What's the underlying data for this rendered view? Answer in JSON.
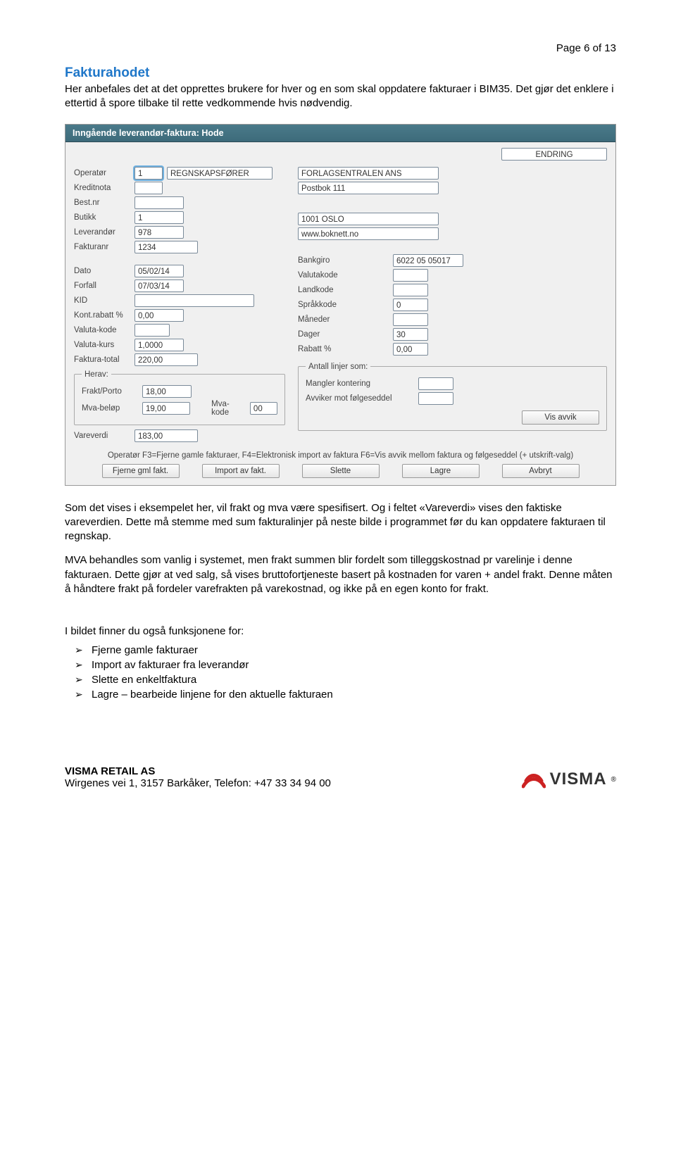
{
  "page_number": "Page 6 of 13",
  "heading": "Fakturahodet",
  "intro": "Her anbefales det at det opprettes brukere for hver og en som skal oppdatere fakturaer i BIM35. Det gjør det enklere i ettertid å spore tilbake til rette vedkommende hvis nødvendig.",
  "form": {
    "title": "Inngående leverandør-faktura: Hode",
    "mode_label": "ENDRING",
    "left": {
      "operator_label": "Operatør",
      "operator_value": "1",
      "operator_name": "REGNSKAPSFØRER",
      "kreditnota_label": "Kreditnota",
      "bestnr_label": "Best.nr",
      "butikk_label": "Butikk",
      "butikk_value": "1",
      "leverandor_label": "Leverandør",
      "leverandor_value": "978",
      "fakturanr_label": "Fakturanr",
      "fakturanr_value": "1234",
      "dato_label": "Dato",
      "dato_value": "05/02/14",
      "forfall_label": "Forfall",
      "forfall_value": "07/03/14",
      "kid_label": "KID",
      "kontrabatt_label": "Kont.rabatt %",
      "kontrabatt_value": "0,00",
      "valutakode_label": "Valuta-kode",
      "valutakurs_label": "Valuta-kurs",
      "valutakurs_value": "1,0000",
      "fakturatotal_label": "Faktura-total",
      "fakturatotal_value": "220,00",
      "herav_legend": "Herav:",
      "fraktporto_label": "Frakt/Porto",
      "fraktporto_value": "18,00",
      "mvabelop_label": "Mva-beløp",
      "mvabelop_value": "19,00",
      "mvakode_label": "Mva-kode",
      "mvakode_value": "00",
      "vareverdi_label": "Vareverdi",
      "vareverdi_value": "183,00"
    },
    "right": {
      "company": "FORLAGSENTRALEN ANS",
      "addr1": "Postbok 111",
      "addr2": "1001 OSLO",
      "url": "www.boknett.no",
      "bankgiro_label": "Bankgiro",
      "bankgiro_value": "6022 05 05017",
      "valutakode_label": "Valutakode",
      "landkode_label": "Landkode",
      "sprakkode_label": "Språkkode",
      "sprakkode_value": "0",
      "maneder_label": "Måneder",
      "dager_label": "Dager",
      "dager_value": "30",
      "rabatt_label": "Rabatt %",
      "rabatt_value": "0,00",
      "antall_linjer_legend": "Antall linjer som:",
      "mangler_kontering_label": "Mangler kontering",
      "avviker_label": "Avviker mot følgeseddel",
      "vis_avvik_btn": "Vis avvik"
    },
    "hint": "Operatør F3=Fjerne gamle fakturaer, F4=Elektronisk import av faktura F6=Vis avvik mellom faktura og følgeseddel (+ utskrift-valg)",
    "buttons": {
      "b1": "Fjerne gml fakt.",
      "b2": "Import av fakt.",
      "b3": "Slette",
      "b4": "Lagre",
      "b5": "Avbryt"
    }
  },
  "para2": "Som det vises i eksempelet her, vil frakt og mva være spesifisert. Og i feltet «Vareverdi» vises den faktiske vareverdien. Dette må stemme med sum fakturalinjer på neste bilde i programmet før du kan oppdatere fakturaen til regnskap.",
  "para3": "MVA behandles som vanlig i systemet, men frakt summen blir fordelt som tilleggskostnad pr varelinje i denne fakturaen. Dette gjør at ved salg, så vises bruttofortjeneste basert på kostnaden for varen + andel frakt. Denne måten å håndtere frakt på fordeler varefrakten på varekostnad, og ikke på en egen konto for frakt.",
  "funcs_intro": "I bildet finner du også funksjonene for:",
  "funcs": {
    "f1": "Fjerne gamle fakturaer",
    "f2": "Import av fakturaer fra leverandør",
    "f3": "Slette en enkeltfaktura",
    "f4": "Lagre – bearbeide linjene for den aktuelle fakturaen"
  },
  "footer": {
    "company": "VISMA RETAIL AS",
    "addr": "Wirgenes vei 1, 3157 Barkåker, Telefon: +47 33 34 94 00",
    "logo_text": "VISMA"
  }
}
